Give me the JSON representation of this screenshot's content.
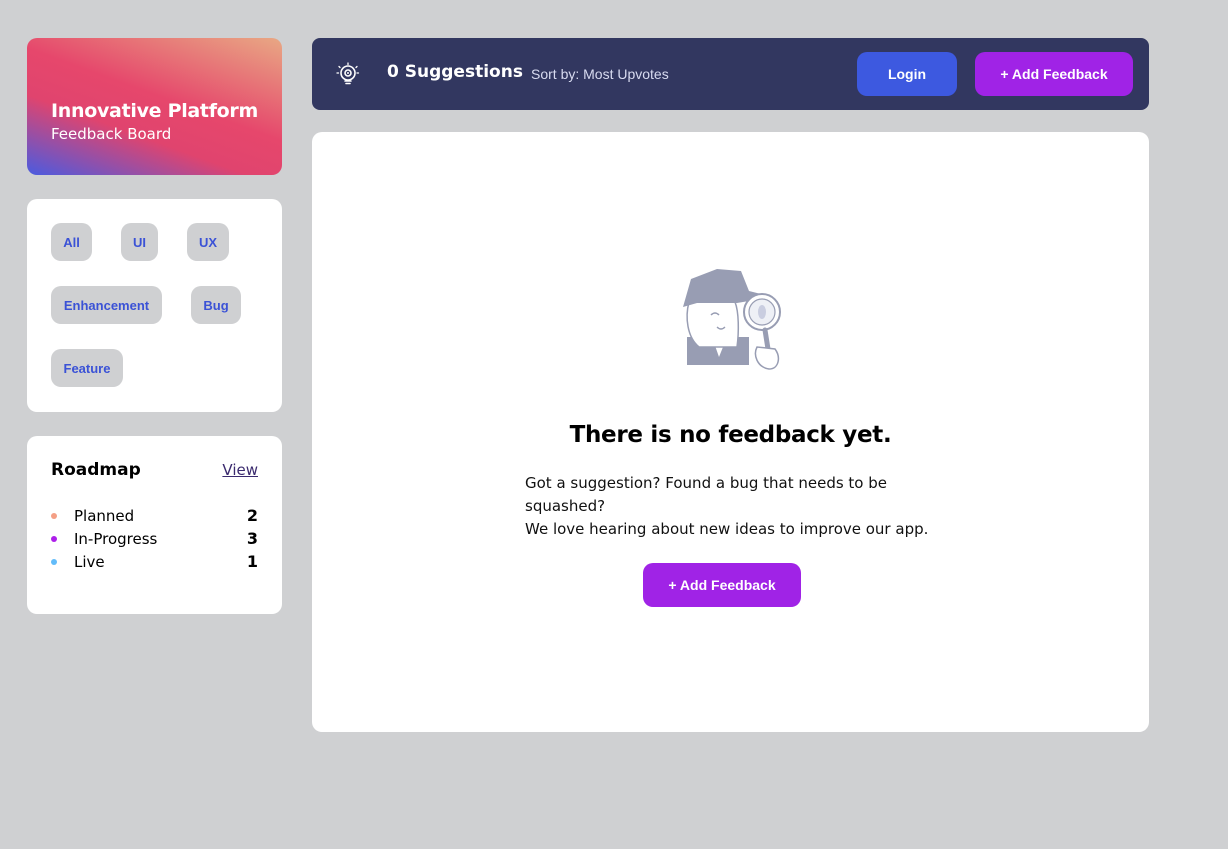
{
  "brand": {
    "title": "Innovative Platform",
    "subtitle": "Feedback Board"
  },
  "tags": [
    "All",
    "UI",
    "UX",
    "Enhancement",
    "Bug",
    "Feature"
  ],
  "roadmap": {
    "title": "Roadmap",
    "view_label": "View",
    "items": [
      {
        "label": "Planned",
        "count": "2",
        "color": "#f49f85"
      },
      {
        "label": "In-Progress",
        "count": "3",
        "color": "#ad1fea"
      },
      {
        "label": "Live",
        "count": "1",
        "color": "#62bcfa"
      }
    ]
  },
  "topbar": {
    "suggestions": "0 Suggestions",
    "sort_label": "Sort by: Most Upvotes",
    "login_label": "Login",
    "add_label": "+ Add Feedback",
    "icon": "bulb-icon"
  },
  "empty": {
    "title": "There is no feedback yet.",
    "line1": "Got a suggestion? Found a bug that needs to be squashed?",
    "line2": "We love hearing about new ideas to improve our app.",
    "add_label": "+ Add Feedback",
    "illustration": "detective-illustration"
  },
  "colors": {
    "accent_purple": "#a023e6",
    "accent_blue": "#3d59e0",
    "navy": "#323760"
  }
}
